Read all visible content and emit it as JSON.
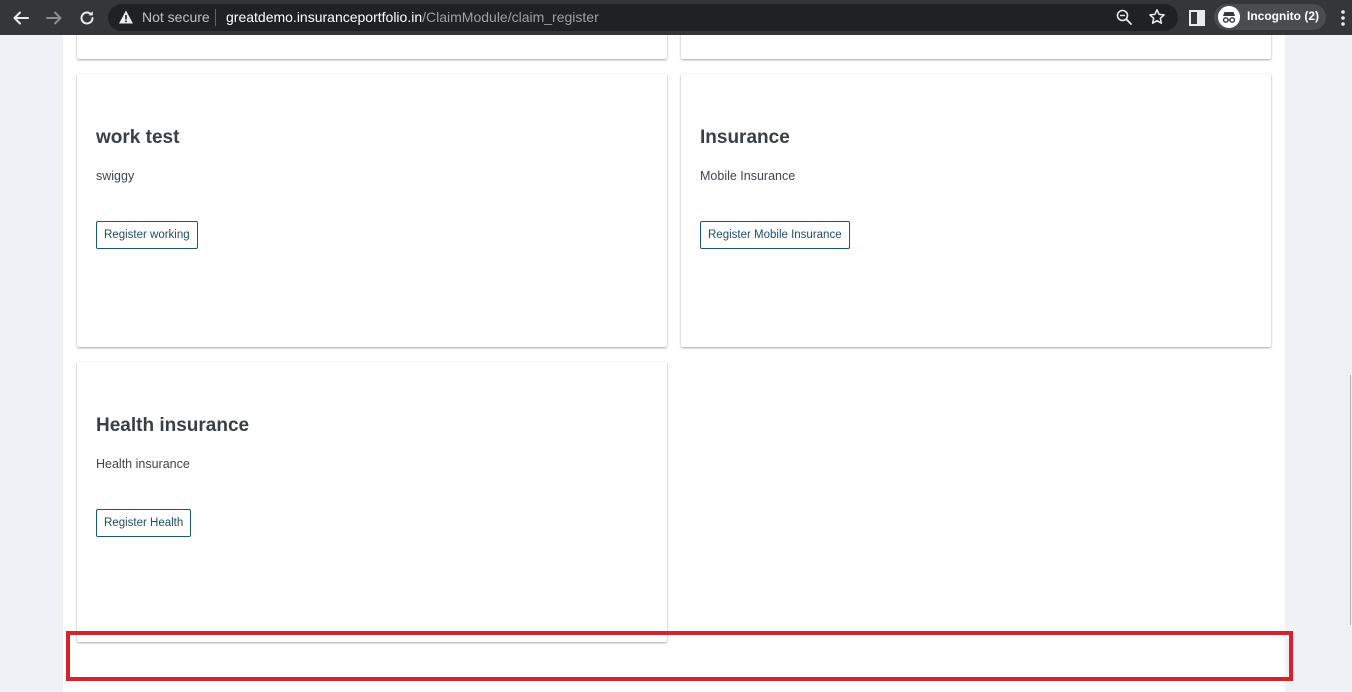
{
  "browser": {
    "not_secure_label": "Not secure",
    "url_host": "greatdemo.insuranceportfolio.in",
    "url_path": "/ClaimModule/claim_register",
    "incognito_label": "Incognito (2)"
  },
  "cards": [
    {
      "title": "work test",
      "description": "swiggy",
      "button_label": "Register working"
    },
    {
      "title": "Insurance",
      "description": "Mobile Insurance",
      "button_label": "Register Mobile Insurance"
    },
    {
      "title": "Health insurance",
      "description": "Health insurance",
      "button_label": "Register Health"
    }
  ],
  "colors": {
    "highlight": "#d5222c",
    "button_border": "#1c5773",
    "chrome_bg": "#35363a"
  }
}
